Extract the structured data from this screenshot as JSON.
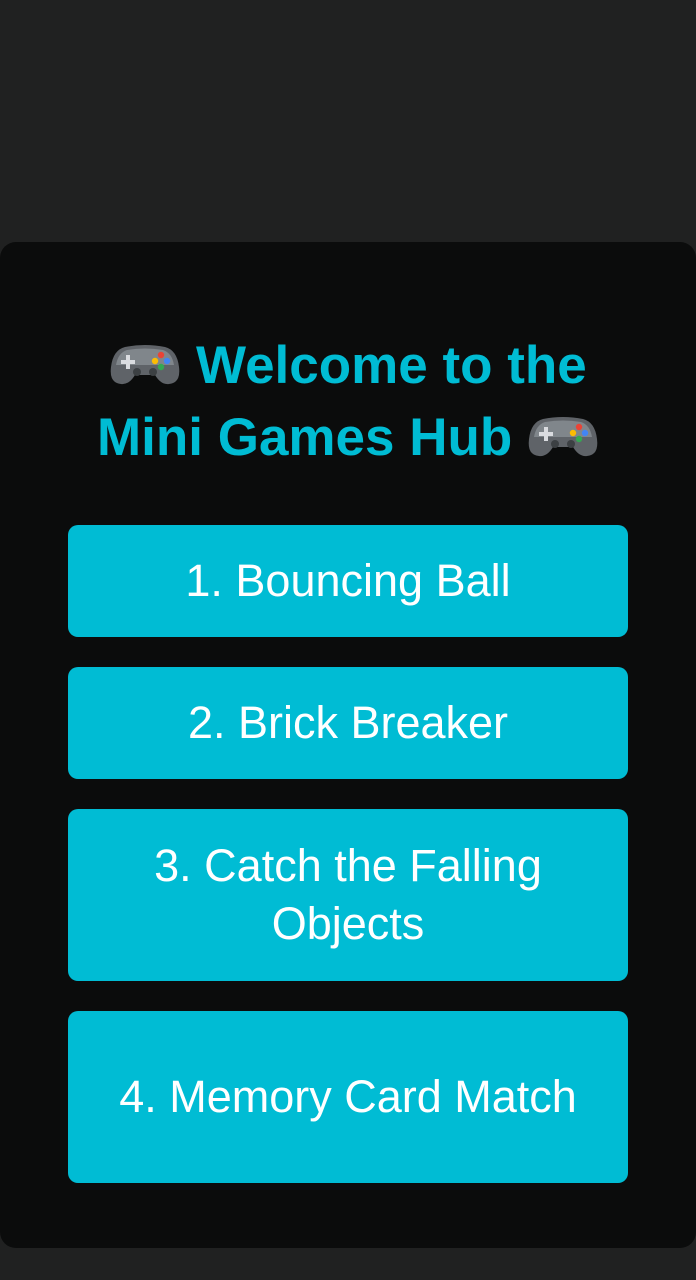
{
  "hub": {
    "title_line1": "Welcome to the",
    "title_line2": "Mini Games Hub",
    "title_icon": "gamepad-icon",
    "accent_color": "#00bcd4",
    "card_color": "#0b0c0c",
    "background_color": "#202121"
  },
  "games": [
    {
      "label": "1. Bouncing Ball"
    },
    {
      "label": "2. Brick Breaker"
    },
    {
      "label": "3. Catch the Falling Objects"
    },
    {
      "label": "4. Memory Card Match"
    }
  ]
}
